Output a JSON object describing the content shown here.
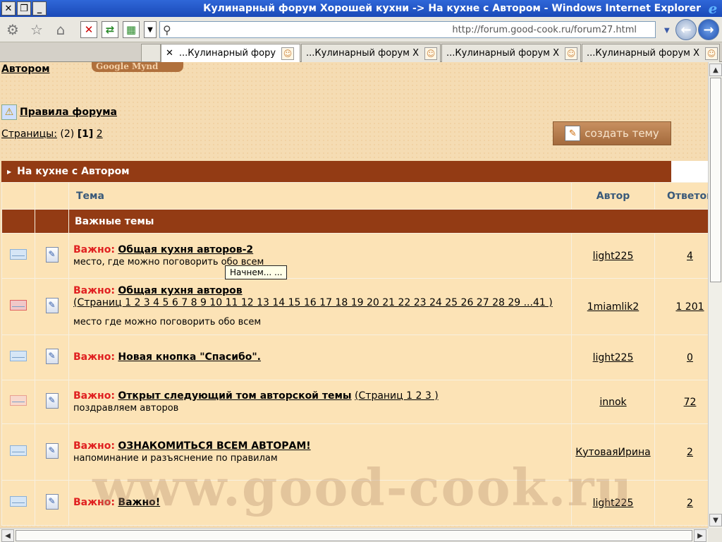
{
  "window": {
    "title": "Кулинарный форум Хорошей кухни -> На кухне с Автором - Windows Internet Explorer",
    "controls": [
      "✕",
      "❐",
      "_"
    ],
    "logo": "e"
  },
  "toolbar": {
    "address": "http://forum.good-cook.ru/forum27.html",
    "icons": [
      "gear-icon",
      "star-icon",
      "home-icon",
      "stop-icon",
      "refresh-icon",
      "feed-icon",
      "dropdown-icon",
      "search-icon"
    ]
  },
  "tabs": [
    {
      "label": "...Кулинарный фору",
      "active": true
    },
    {
      "label": "...Кулинарный форум Х"
    },
    {
      "label": "...Кулинарный форум Х"
    },
    {
      "label": "...Кулинарный форум Х"
    }
  ],
  "page": {
    "author_link": "Автором",
    "google_tab": "Google Mynd",
    "rules_link": "Правила форума",
    "pages_label": "Страницы:",
    "pages_total": "(2)",
    "pages_current": "[1]",
    "pages_next": "2",
    "create_button": "создать тему",
    "forum_bar": "На кухне с Автором",
    "columns": {
      "topic": "Тема",
      "author": "Автор",
      "replies": "Ответов"
    },
    "section": "Важные темы",
    "important_prefix": "Важно:",
    "topics": [
      {
        "title": "Общая кухня авторов-2",
        "pages_text": "",
        "desc": "место, где можно поговорить обо всем",
        "author": "light225",
        "replies": "4",
        "icon": "envelope"
      },
      {
        "title": "Общая кухня авторов",
        "pages_text": "(Страниц 1 2 3 4 5 6 7 8 9 10 11 12 13 14 15 16 17 18 19 20 21 22 23 24 25 26 27 28 29 ...41 )",
        "desc": "место где можно поговорить обо всем",
        "author": "1miamlik2",
        "replies": "1 201",
        "icon": "hot-envelope"
      },
      {
        "title": "Новая кнопка \"Спасибо\".",
        "pages_text": "",
        "desc": "",
        "author": "light225",
        "replies": "0",
        "icon": "envelope"
      },
      {
        "title": "Открыт следующий том авторской темы",
        "pages_text": "(Страниц 1 2 3 )",
        "desc": "поздравляем авторов",
        "author": "innok",
        "replies": "72",
        "icon": "pink-envelope"
      },
      {
        "title": "ОЗНАКОМИТЬСЯ ВСЕМ АВТОРАМ!",
        "pages_text": "",
        "desc": "напоминание и разъяснение по правилам",
        "author": "КутоваяИрина",
        "replies": "2",
        "icon": "envelope"
      },
      {
        "title": "Важно!",
        "pages_text": "",
        "desc": "",
        "author": "light225",
        "replies": "2",
        "icon": "envelope"
      }
    ],
    "tooltip": "Начнем... ...",
    "watermark": "www.good-cook.ru"
  }
}
